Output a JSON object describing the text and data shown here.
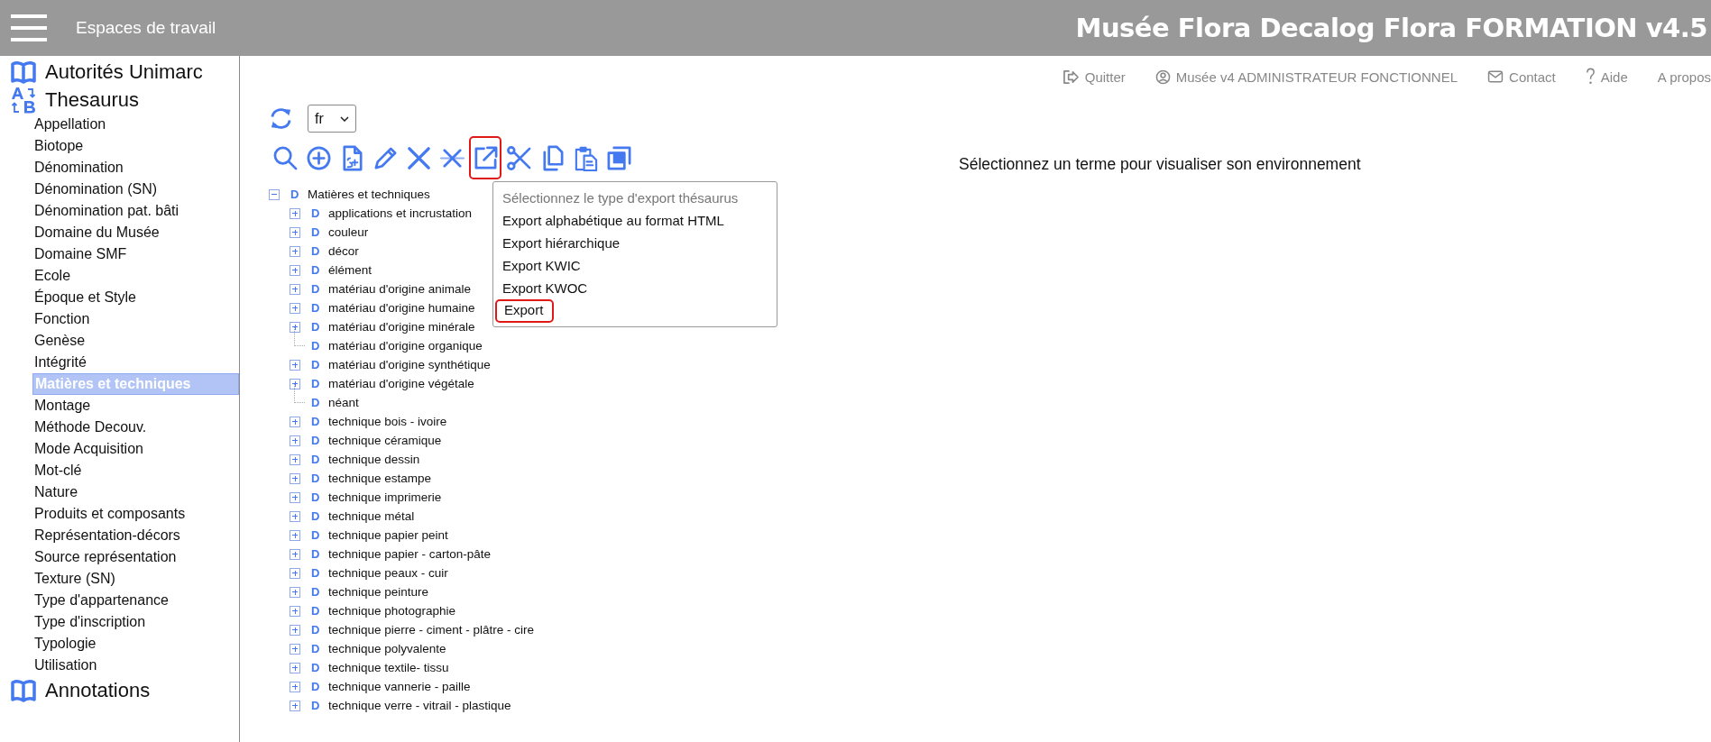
{
  "header": {
    "menu_label": "Espaces de travail",
    "title": "Musée Flora Decalog Flora FORMATION v4.5"
  },
  "top_links": [
    {
      "kind": "logout",
      "label": "Quitter"
    },
    {
      "kind": "user",
      "label": "Musée v4 ADMINISTRATEUR FONCTIONNEL"
    },
    {
      "kind": "mail",
      "label": "Contact"
    },
    {
      "kind": "help",
      "label": "Aide"
    },
    {
      "kind": "none",
      "label": "A propos"
    }
  ],
  "sidebar": [
    {
      "kind": "book",
      "title": "Autorités Unimarc"
    },
    {
      "kind": "az",
      "title": "Thesaurus",
      "items": [
        {
          "label": "Appellation",
          "selected": false
        },
        {
          "label": "Biotope",
          "selected": false
        },
        {
          "label": "Dénomination",
          "selected": false
        },
        {
          "label": "Dénomination (SN)",
          "selected": false
        },
        {
          "label": "Dénomination pat. bâti",
          "selected": false
        },
        {
          "label": "Domaine du Musée",
          "selected": false
        },
        {
          "label": "Domaine SMF",
          "selected": false
        },
        {
          "label": "Ecole",
          "selected": false
        },
        {
          "label": "Époque et Style",
          "selected": false
        },
        {
          "label": "Fonction",
          "selected": false
        },
        {
          "label": "Genèse",
          "selected": false
        },
        {
          "label": "Intégrité",
          "selected": false
        },
        {
          "label": "Matières et techniques",
          "selected": true
        },
        {
          "label": "Montage",
          "selected": false
        },
        {
          "label": "Méthode Decouv.",
          "selected": false
        },
        {
          "label": "Mode Acquisition",
          "selected": false
        },
        {
          "label": "Mot-clé",
          "selected": false
        },
        {
          "label": "Nature",
          "selected": false
        },
        {
          "label": "Produits et composants",
          "selected": false
        },
        {
          "label": "Représentation-décors",
          "selected": false
        },
        {
          "label": "Source représentation",
          "selected": false
        },
        {
          "label": "Texture (SN)",
          "selected": false
        },
        {
          "label": "Type d'appartenance",
          "selected": false
        },
        {
          "label": "Type d'inscription",
          "selected": false
        },
        {
          "label": "Typologie",
          "selected": false
        },
        {
          "label": "Utilisation",
          "selected": false
        }
      ]
    },
    {
      "kind": "book",
      "title": "Annotations"
    }
  ],
  "language": {
    "value": "fr"
  },
  "toolbar": [
    {
      "kind": "search",
      "highlighted": false
    },
    {
      "kind": "add",
      "highlighted": false
    },
    {
      "kind": "file",
      "highlighted": false
    },
    {
      "kind": "edit",
      "highlighted": false
    },
    {
      "kind": "delete",
      "highlighted": false
    },
    {
      "kind": "strike",
      "highlighted": false
    },
    {
      "kind": "export",
      "highlighted": true
    },
    {
      "kind": "cut",
      "highlighted": false
    },
    {
      "kind": "copy",
      "highlighted": false
    },
    {
      "kind": "paste",
      "highlighted": false
    },
    {
      "kind": "stack",
      "highlighted": false
    }
  ],
  "export_menu": {
    "heading": "Sélectionnez le type d'export thésaurus",
    "items": [
      {
        "label": "Export alphabétique au format HTML",
        "highlighted": false
      },
      {
        "label": "Export hiérarchique",
        "highlighted": false
      },
      {
        "label": "Export KWIC",
        "highlighted": false
      },
      {
        "label": "Export KWOC",
        "highlighted": false
      },
      {
        "label": "Export",
        "highlighted": true
      }
    ]
  },
  "tree": {
    "badge": "D",
    "label": "Matières et techniques",
    "expanded": true,
    "children": [
      {
        "badge": "D",
        "label": "applications et incrustation",
        "kind": "branch",
        "expanded": false
      },
      {
        "badge": "D",
        "label": "couleur",
        "kind": "branch",
        "expanded": false
      },
      {
        "badge": "D",
        "label": "décor",
        "kind": "branch",
        "expanded": false
      },
      {
        "badge": "D",
        "label": "élément",
        "kind": "branch",
        "expanded": false
      },
      {
        "badge": "D",
        "label": "matériau d'origine animale",
        "kind": "branch",
        "expanded": false
      },
      {
        "badge": "D",
        "label": "matériau d'origine humaine",
        "kind": "branch",
        "expanded": false
      },
      {
        "badge": "D",
        "label": "matériau d'origine minérale",
        "kind": "branch",
        "expanded": false
      },
      {
        "badge": "D",
        "label": "matériau d'origine organique",
        "kind": "leaf"
      },
      {
        "badge": "D",
        "label": "matériau d'origine synthétique",
        "kind": "branch",
        "expanded": false
      },
      {
        "badge": "D",
        "label": "matériau d'origine végétale",
        "kind": "branch",
        "expanded": false
      },
      {
        "badge": "D",
        "label": "néant",
        "kind": "leaf"
      },
      {
        "badge": "D",
        "label": "technique bois - ivoire",
        "kind": "branch",
        "expanded": false
      },
      {
        "badge": "D",
        "label": "technique céramique",
        "kind": "branch",
        "expanded": false
      },
      {
        "badge": "D",
        "label": "technique dessin",
        "kind": "branch",
        "expanded": false
      },
      {
        "badge": "D",
        "label": "technique estampe",
        "kind": "branch",
        "expanded": false
      },
      {
        "badge": "D",
        "label": "technique imprimerie",
        "kind": "branch",
        "expanded": false
      },
      {
        "badge": "D",
        "label": "technique métal",
        "kind": "branch",
        "expanded": false
      },
      {
        "badge": "D",
        "label": "technique papier peint",
        "kind": "branch",
        "expanded": false
      },
      {
        "badge": "D",
        "label": "technique papier - carton-pâte",
        "kind": "branch",
        "expanded": false
      },
      {
        "badge": "D",
        "label": "technique peaux - cuir",
        "kind": "branch",
        "expanded": false
      },
      {
        "badge": "D",
        "label": "technique peinture",
        "kind": "branch",
        "expanded": false
      },
      {
        "badge": "D",
        "label": "technique photographie",
        "kind": "branch",
        "expanded": false
      },
      {
        "badge": "D",
        "label": "technique pierre - ciment - plâtre - cire",
        "kind": "branch",
        "expanded": false
      },
      {
        "badge": "D",
        "label": "technique polyvalente",
        "kind": "branch",
        "expanded": false
      },
      {
        "badge": "D",
        "label": "technique textile- tissu",
        "kind": "branch",
        "expanded": false
      },
      {
        "badge": "D",
        "label": "technique vannerie - paille",
        "kind": "branch",
        "expanded": false
      },
      {
        "badge": "D",
        "label": "technique verre - vitrail - plastique",
        "kind": "branch",
        "expanded": false
      }
    ]
  },
  "message": "Sélectionnez un terme pour visualiser son environnement"
}
